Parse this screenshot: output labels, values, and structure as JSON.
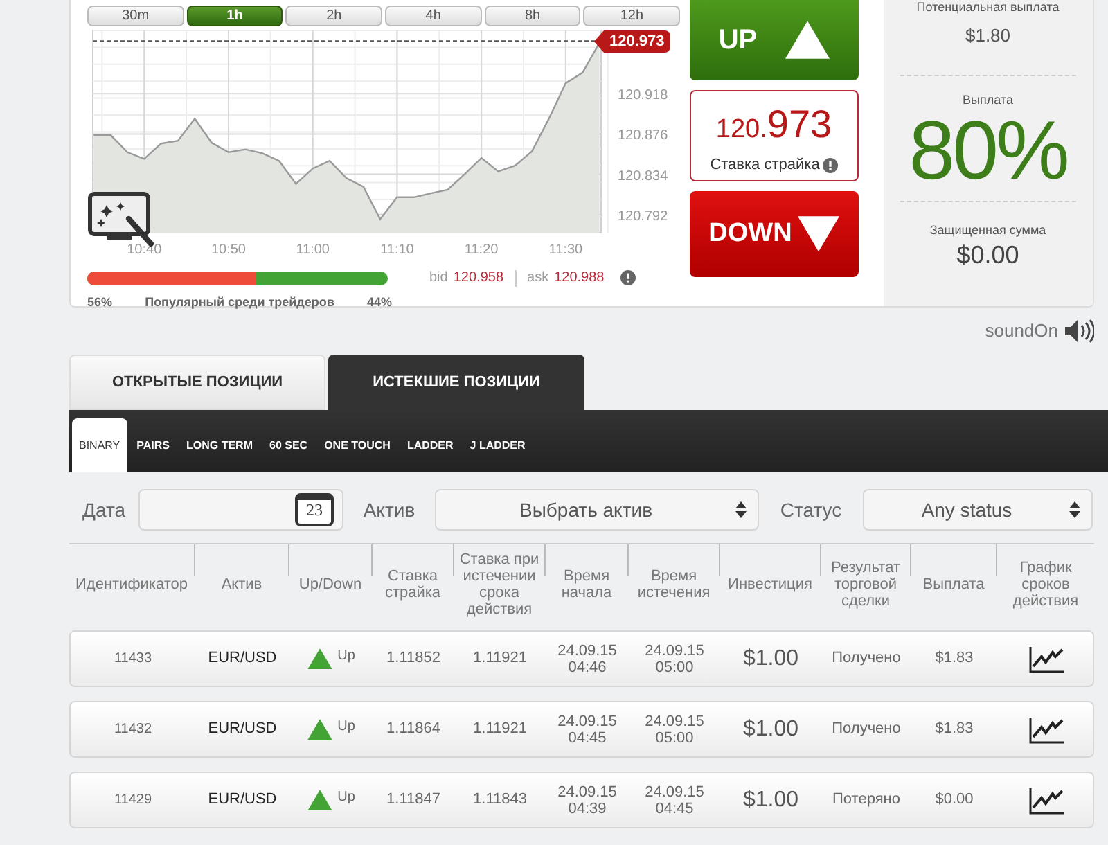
{
  "timeframes": [
    {
      "label": "30m",
      "selected": false
    },
    {
      "label": "1h",
      "selected": true
    },
    {
      "label": "2h",
      "selected": false
    },
    {
      "label": "4h",
      "selected": false
    },
    {
      "label": "8h",
      "selected": false
    },
    {
      "label": "12h",
      "selected": false
    }
  ],
  "chart": {
    "chart_data": {
      "type": "area",
      "categories": [
        null,
        null,
        null,
        "10:40",
        null,
        null,
        null,
        null,
        "10:50",
        null,
        null,
        null,
        null,
        "11:00",
        null,
        null,
        null,
        null,
        "11:10",
        null,
        null,
        null,
        null,
        "11:20",
        null,
        null,
        null,
        null,
        "11:30",
        null,
        null
      ],
      "values": [
        120.875,
        120.875,
        120.857,
        120.85,
        120.866,
        120.869,
        120.892,
        120.867,
        120.857,
        120.86,
        120.856,
        120.848,
        120.824,
        120.84,
        120.848,
        120.83,
        120.821,
        120.787,
        120.81,
        120.81,
        120.814,
        120.818,
        120.834,
        120.851,
        120.837,
        120.843,
        120.858,
        120.892,
        120.929,
        120.94,
        120.971
      ],
      "ylim": [
        120.773,
        120.984
      ],
      "yticks": [
        {
          "value": 120.792,
          "label": "120.792"
        },
        {
          "value": 120.834,
          "label": "120.834"
        },
        {
          "value": 120.876,
          "label": "120.876"
        },
        {
          "value": 120.918,
          "label": "120.918"
        }
      ],
      "grid": true,
      "ref_lines": [
        {
          "axis": "y",
          "value": 120.973,
          "label": "120.973"
        }
      ]
    }
  },
  "popularity": {
    "down_percent": "56%",
    "label": "Популярный среди трейдеров",
    "up_percent": "44%",
    "level": 0.56
  },
  "quote": {
    "bid_label": "bid",
    "bid": "120.958",
    "ask_label": "ask",
    "ask": "120.988"
  },
  "trade": {
    "up_button": "UP",
    "strike_integer": "120.",
    "strike_decimals": "973",
    "strike_label": "Ставка страйка",
    "down_button": "DOWN"
  },
  "payout_panel": {
    "potential_label": "Потенциальная выплата",
    "potential_value": "$1.80",
    "payout_label": "Выплата",
    "payout_value": "80%",
    "protected_label": "Защищенная сумма",
    "protected_value": "$0.00"
  },
  "sound": {
    "label": "soundOn"
  },
  "position_tabs": [
    {
      "label": "ОТКРЫТЫЕ ПОЗИЦИИ",
      "selected": false
    },
    {
      "label": "ИСТЕКШИЕ ПОЗИЦИИ",
      "selected": true
    }
  ],
  "product_tabs": [
    {
      "label": "BINARY",
      "selected": true
    },
    {
      "label": "PAIRS",
      "selected": false
    },
    {
      "label": "LONG TERM",
      "selected": false
    },
    {
      "label": "60 SEC",
      "selected": false
    },
    {
      "label": "ONE TOUCH",
      "selected": false
    },
    {
      "label": "LADDER",
      "selected": false
    },
    {
      "label": "J LADDER",
      "selected": false
    }
  ],
  "filters": {
    "date_label": "Дата",
    "calendar_day": "23",
    "asset_label": "Актив",
    "asset_value": "Выбрать актив",
    "status_label": "Статус",
    "status_value": "Any status"
  },
  "table": {
    "columns": [
      "Идентификатор",
      "Актив",
      "Up/Down",
      "Ставка страйка",
      "Ставка при истечении срока действия",
      "Время начала",
      "Время истечения",
      "Инвестиция",
      "Результат торговой сделки",
      "Выплата",
      "График сроков действия"
    ],
    "rows": [
      {
        "id": "11433",
        "asset": "EUR/USD",
        "direction": {
          "kind": "up",
          "label": "Up"
        },
        "strike": "1.11852",
        "expiry_rate": "1.11921",
        "start": "24.09.15\n04:46",
        "expiry": "24.09.15\n05:00",
        "investment": "$1.00",
        "result": "Получено",
        "payout": "$1.83"
      },
      {
        "id": "11432",
        "asset": "EUR/USD",
        "direction": {
          "kind": "up",
          "label": "Up"
        },
        "strike": "1.11864",
        "expiry_rate": "1.11921",
        "start": "24.09.15\n04:45",
        "expiry": "24.09.15\n05:00",
        "investment": "$1.00",
        "result": "Получено",
        "payout": "$1.83"
      },
      {
        "id": "11429",
        "asset": "EUR/USD",
        "direction": {
          "kind": "up",
          "label": "Up"
        },
        "strike": "1.11847",
        "expiry_rate": "1.11843",
        "start": "24.09.15\n04:39",
        "expiry": "24.09.15\n04:45",
        "investment": "$1.00",
        "result": "Потеряно",
        "payout": "$0.00"
      }
    ]
  }
}
